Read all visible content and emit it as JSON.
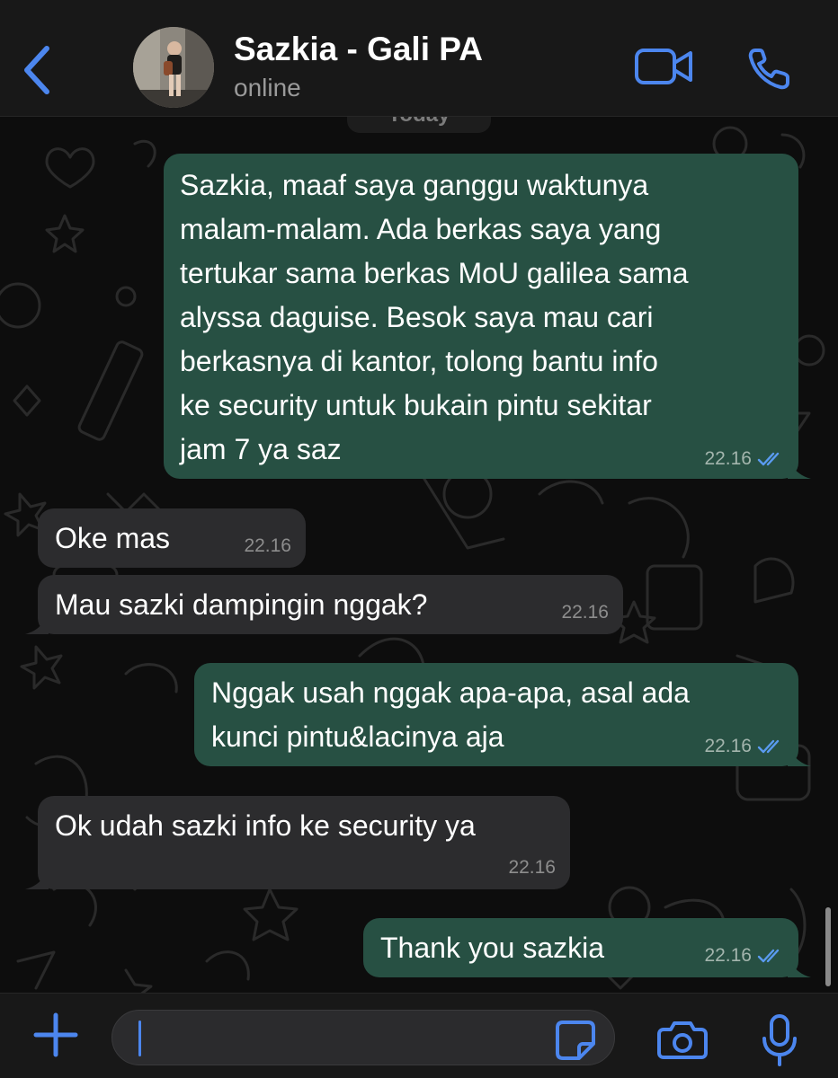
{
  "colors": {
    "accent": "#4c86ee",
    "header_bg": "#181818",
    "outgoing_bubble": "#275043",
    "incoming_bubble": "#2c2c2e",
    "read_ticks": "#5a9bf0"
  },
  "header": {
    "back_icon": "chevron-left-icon",
    "contact_name": "Sazkia - Gali PA",
    "status": "online",
    "video_icon": "video-camera-icon",
    "call_icon": "phone-icon"
  },
  "chat": {
    "date_separator": "Today",
    "messages": [
      {
        "direction": "outgoing",
        "lines": [
          "Sazkia, maaf saya ganggu waktunya",
          "malam-malam. Ada berkas saya yang",
          "tertukar sama berkas MoU galilea sama",
          "alyssa daguise. Besok saya mau cari",
          "berkasnya di kantor, tolong bantu info",
          "ke security untuk bukain pintu sekitar",
          "jam 7 ya saz"
        ],
        "time": "22.16",
        "status": "read"
      },
      {
        "direction": "incoming",
        "lines": [
          "Oke mas"
        ],
        "time": "22.16"
      },
      {
        "direction": "incoming",
        "lines": [
          "Mau sazki dampingin nggak?"
        ],
        "time": "22.16"
      },
      {
        "direction": "outgoing",
        "lines": [
          "Nggak usah nggak apa-apa, asal ada",
          "kunci pintu&lacinya aja"
        ],
        "time": "22.16",
        "status": "read"
      },
      {
        "direction": "incoming",
        "lines": [
          "Ok udah sazki info ke security ya"
        ],
        "time": "22.16"
      },
      {
        "direction": "outgoing",
        "lines": [
          "Thank you sazkia"
        ],
        "time": "22.16",
        "status": "read"
      }
    ]
  },
  "composer": {
    "attach_icon": "plus-icon",
    "message_value": "",
    "sticker_icon": "sticker-icon",
    "camera_icon": "camera-icon",
    "mic_icon": "microphone-icon"
  }
}
